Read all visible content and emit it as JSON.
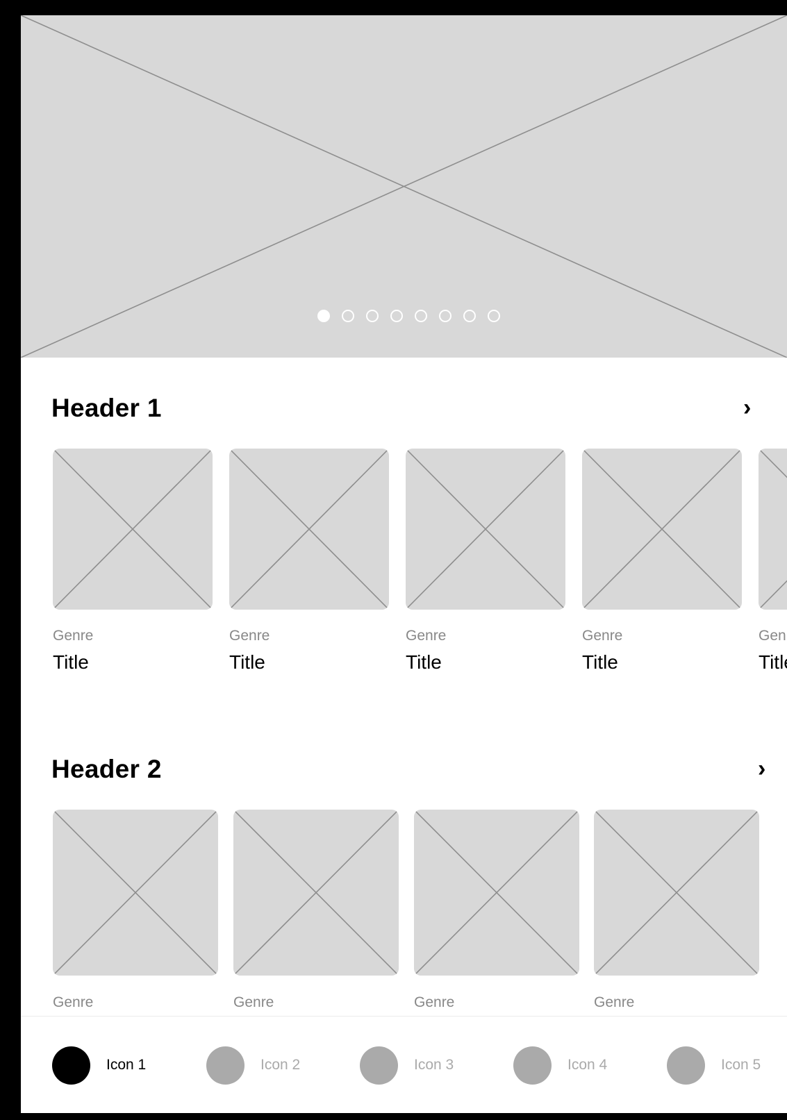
{
  "carousel": {
    "dot_count": 8,
    "active_index": 0
  },
  "section1": {
    "header": "Header 1",
    "chevron": "›",
    "items": [
      {
        "genre": "Genre",
        "title": "Title"
      },
      {
        "genre": "Genre",
        "title": "Title"
      },
      {
        "genre": "Genre",
        "title": "Title"
      },
      {
        "genre": "Genre",
        "title": "Title"
      },
      {
        "genre": "Genre",
        "title": "Title"
      }
    ]
  },
  "section2": {
    "header": "Header 2",
    "chevron": "›",
    "items": [
      {
        "genre": "Genre"
      },
      {
        "genre": "Genre"
      },
      {
        "genre": "Genre"
      },
      {
        "genre": "Genre"
      }
    ]
  },
  "tabbar": {
    "active_index": 0,
    "tabs": [
      {
        "label": "Icon 1"
      },
      {
        "label": "Icon 2"
      },
      {
        "label": "Icon 3"
      },
      {
        "label": "Icon 4"
      },
      {
        "label": "Icon 5"
      }
    ]
  }
}
